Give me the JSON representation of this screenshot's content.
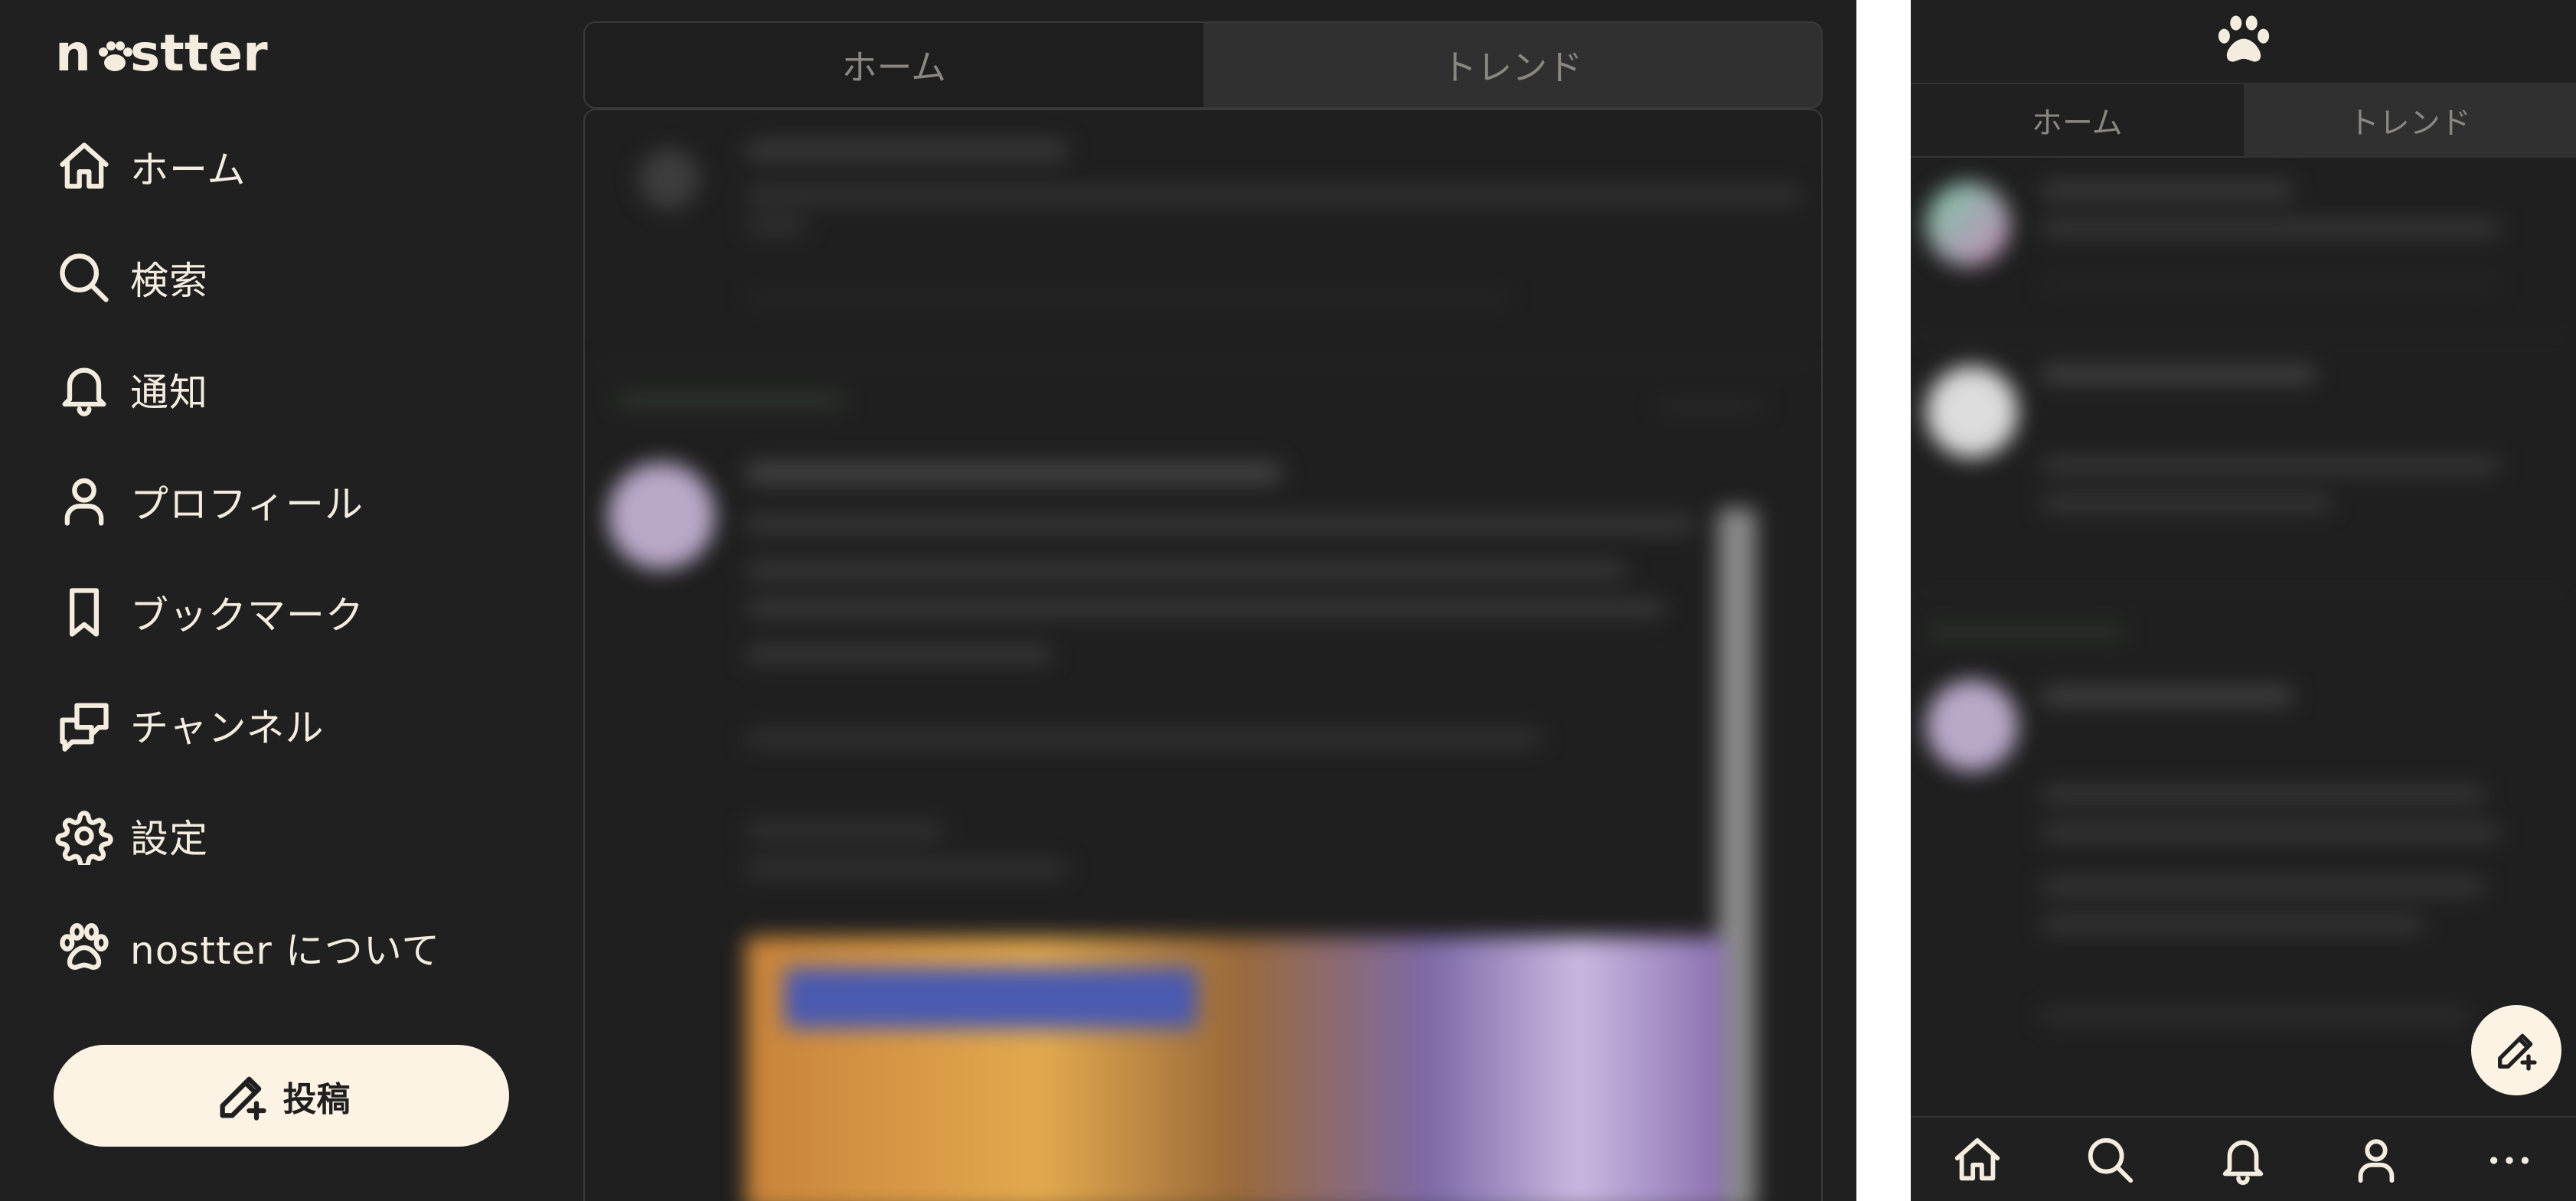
{
  "app": {
    "name": "nostter"
  },
  "desktop": {
    "nav": [
      {
        "label": "ホーム",
        "icon": "home-icon"
      },
      {
        "label": "検索",
        "icon": "search-icon"
      },
      {
        "label": "通知",
        "icon": "bell-icon"
      },
      {
        "label": "プロフィール",
        "icon": "user-icon"
      },
      {
        "label": "ブックマーク",
        "icon": "bookmark-icon"
      },
      {
        "label": "チャンネル",
        "icon": "messages-icon"
      },
      {
        "label": "設定",
        "icon": "gear-icon"
      },
      {
        "label": "nostter について",
        "icon": "paw-icon"
      }
    ],
    "post_button": {
      "label": "投稿",
      "icon": "pencil-plus-icon"
    },
    "tabs": [
      {
        "label": "ホーム",
        "active": true
      },
      {
        "label": "トレンド",
        "active": false
      }
    ]
  },
  "mobile": {
    "tabs": [
      {
        "label": "ホーム",
        "active": true
      },
      {
        "label": "トレンド",
        "active": false
      }
    ],
    "bottom_nav": [
      "home-icon",
      "search-icon",
      "bell-icon",
      "user-icon",
      "more-icon"
    ],
    "fab": "pencil-plus-icon"
  },
  "colors": {
    "background": "#202020",
    "text": "#f3ecdf",
    "button": "#fdf3e5",
    "tab_inactive": "#303030"
  }
}
